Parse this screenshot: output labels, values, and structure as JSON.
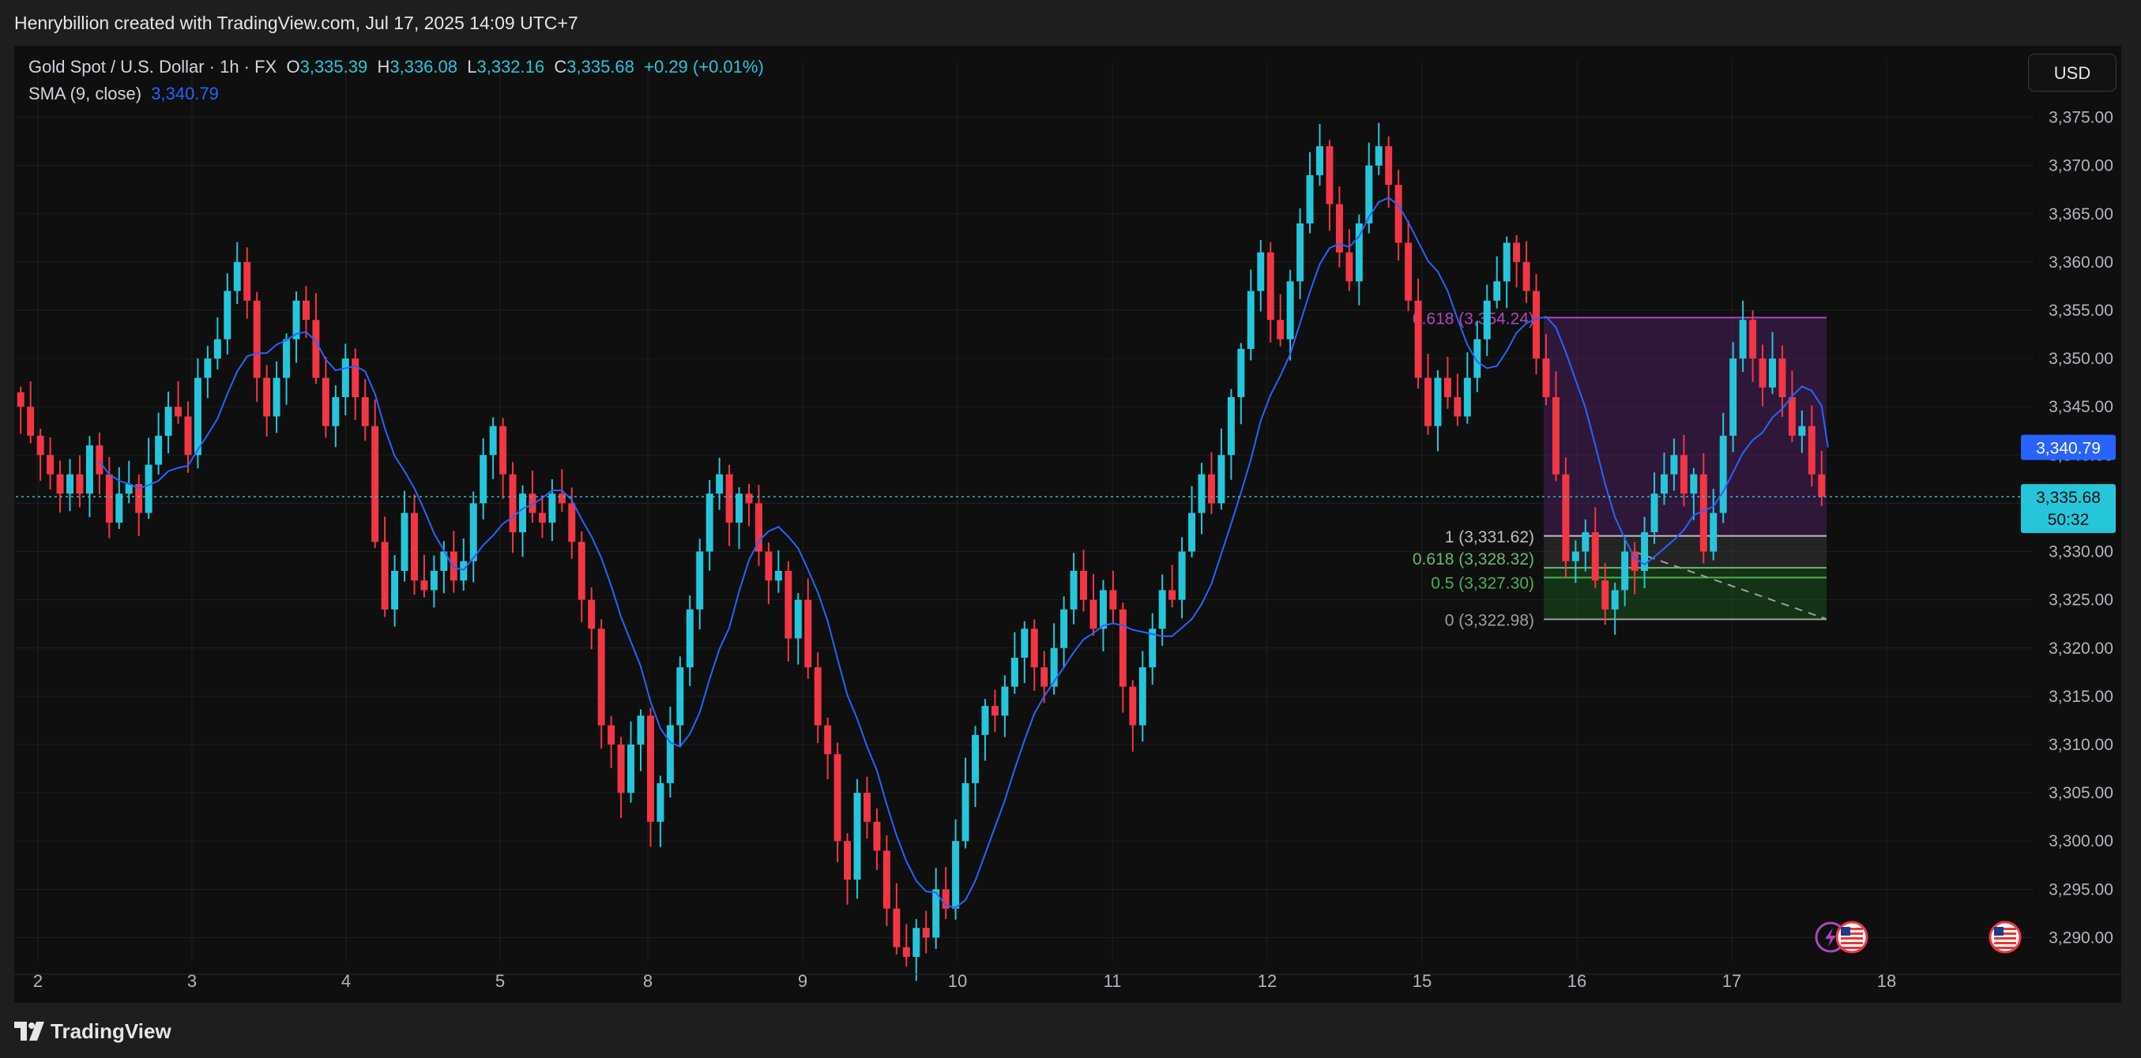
{
  "header": {
    "caption": "Henrybillion created with TradingView.com, Jul 17, 2025 14:09 UTC+7"
  },
  "legend": {
    "symbol": "Gold Spot / U.S. Dollar · 1h · FX",
    "open_label": "O",
    "open": "3,335.39",
    "high_label": "H",
    "high": "3,336.08",
    "low_label": "L",
    "low": "3,332.16",
    "close_label": "C",
    "close": "3,335.68",
    "change": "+0.29 (+0.01%)",
    "sma_label": "SMA (9, close)",
    "sma_value": "3,340.79"
  },
  "currency_button": "USD",
  "footer": {
    "brand": "TradingView"
  },
  "colors": {
    "up": "#26c6da",
    "down": "#f23645",
    "sma": "#2962ff",
    "fib_top": "#ab47bc",
    "fib_zone_green": "#1b5e20",
    "grid": "#1f1f1f",
    "price_badge": "#2962ff",
    "current_badge": "#26c6da"
  },
  "icons": [
    "lightning-icon",
    "us-flag-icon"
  ],
  "chart_data": {
    "type": "candlestick",
    "title": "Gold Spot / U.S. Dollar",
    "timeframe": "1h",
    "x_ticks": [
      "2",
      "3",
      "4",
      "5",
      "8",
      "9",
      "10",
      "11",
      "12",
      "15",
      "16",
      "17",
      "18"
    ],
    "y_ticks": [
      "3,375.00",
      "3,370.00",
      "3,365.00",
      "3,360.00",
      "3,355.00",
      "3,350.00",
      "3,345.00",
      "3,340.00",
      "3,335.00",
      "3,330.00",
      "3,325.00",
      "3,320.00",
      "3,315.00",
      "3,310.00",
      "3,305.00",
      "3,300.00",
      "3,295.00",
      "3,290.00"
    ],
    "ylim": [
      3287.5,
      3377.5
    ],
    "current_price": 3335.68,
    "current_price_label": "3,335.68",
    "countdown": "50:32",
    "sma_price_label": "3,340.79",
    "sma_value": 3340.79,
    "closes": [
      3345,
      3342,
      3340,
      3338,
      3336,
      3338,
      3336,
      3341,
      3338,
      3333,
      3336,
      3337,
      3334,
      3339,
      3342,
      3345,
      3344,
      3340,
      3348,
      3350,
      3352,
      3357,
      3360,
      3356,
      3348,
      3344,
      3348,
      3352,
      3356,
      3354,
      3348,
      3343,
      3346,
      3350,
      3346,
      3343,
      3331,
      3324,
      3328,
      3334,
      3327,
      3326,
      3328,
      3330,
      3327,
      3329,
      3335,
      3340,
      3343,
      3338,
      3332,
      3336,
      3334,
      3333,
      3336,
      3335,
      3331,
      3325,
      3322,
      3312,
      3310,
      3305,
      3310,
      3313,
      3302,
      3306,
      3312,
      3318,
      3324,
      3330,
      3336,
      3338,
      3333,
      3336,
      3335,
      3330,
      3327,
      3328,
      3321,
      3325,
      3318,
      3312,
      3309,
      3300,
      3296,
      3305,
      3302,
      3299,
      3293,
      3289,
      3288,
      3291,
      3290,
      3295,
      3293,
      3300,
      3306,
      3311,
      3314,
      3313,
      3316,
      3319,
      3322,
      3318,
      3316,
      3320,
      3324,
      3328,
      3325,
      3322,
      3326,
      3324,
      3316,
      3312,
      3318,
      3322,
      3326,
      3325,
      3330,
      3334,
      3338,
      3335,
      3340,
      3346,
      3351,
      3357,
      3361,
      3354,
      3352,
      3358,
      3364,
      3369,
      3372,
      3366,
      3361,
      3358,
      3364,
      3370,
      3372,
      3368,
      3362,
      3356,
      3348,
      3343,
      3348,
      3346,
      3344,
      3348,
      3352,
      3356,
      3358,
      3362,
      3360,
      3357,
      3350,
      3346,
      3338,
      3329,
      3330,
      3332,
      3327,
      3324,
      3326,
      3330,
      3328,
      3332,
      3336,
      3338,
      3340,
      3336,
      3338,
      3330,
      3334,
      3342,
      3350,
      3354,
      3350,
      3347,
      3350,
      3346,
      3342,
      3343,
      3338,
      3335.68
    ]
  },
  "fib": {
    "top_label": "0.618 (3,354.24)",
    "top_price": 3354.24,
    "levels": [
      {
        "label": "1 (3,331.62)",
        "price": 3331.62,
        "color": "#bdbdbd"
      },
      {
        "label": "0.618 (3,328.32)",
        "price": 3328.32,
        "color": "#66bb6a"
      },
      {
        "label": "0.5 (3,327.30)",
        "price": 3327.3,
        "color": "#4caf50"
      },
      {
        "label": "0 (3,322.98)",
        "price": 3322.98,
        "color": "#9e9e9e"
      }
    ]
  }
}
